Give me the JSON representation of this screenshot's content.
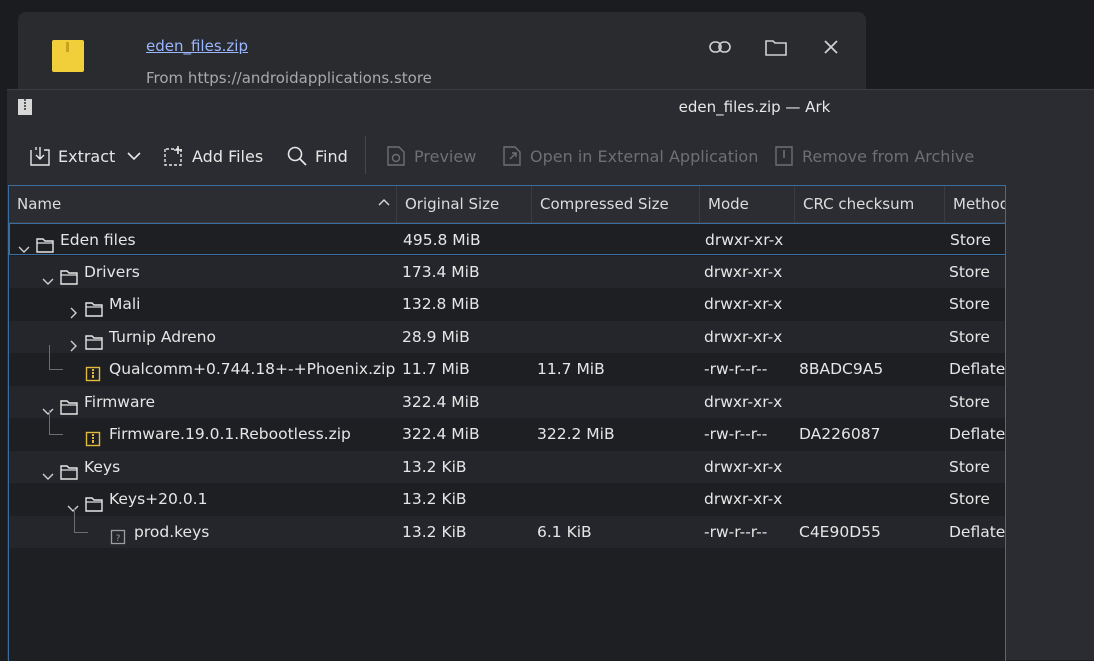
{
  "notification": {
    "filename": "eden_files.zip",
    "source": "From https://androidapplications.store"
  },
  "window": {
    "title": "eden_files.zip — Ark"
  },
  "toolbar": {
    "extract": "Extract",
    "add_files": "Add Files",
    "find": "Find",
    "preview": "Preview",
    "open_external": "Open in External Application",
    "remove": "Remove from Archive"
  },
  "columns": [
    "Name",
    "Original Size",
    "Compressed Size",
    "Mode",
    "CRC checksum",
    "Method"
  ],
  "rows": [
    {
      "name": "Eden files",
      "size": "495.8 MiB",
      "compressed": "",
      "mode": "drwxr-xr-x",
      "crc": "",
      "method": "Store",
      "type": "folder",
      "depth": 0,
      "expanded": true
    },
    {
      "name": "Drivers",
      "size": "173.4 MiB",
      "compressed": "",
      "mode": "drwxr-xr-x",
      "crc": "",
      "method": "Store",
      "type": "folder",
      "depth": 1,
      "expanded": true
    },
    {
      "name": "Mali",
      "size": "132.8 MiB",
      "compressed": "",
      "mode": "drwxr-xr-x",
      "crc": "",
      "method": "Store",
      "type": "folder",
      "depth": 2,
      "expanded": false
    },
    {
      "name": "Turnip Adreno",
      "size": "28.9 MiB",
      "compressed": "",
      "mode": "drwxr-xr-x",
      "crc": "",
      "method": "Store",
      "type": "folder",
      "depth": 2,
      "expanded": false
    },
    {
      "name": "Qualcomm+0.744.18+-+Phoenix.zip",
      "size": "11.7 MiB",
      "compressed": "11.7 MiB",
      "mode": "-rw-r--r--",
      "crc": "8BADC9A5",
      "method": "Deflate",
      "type": "zip",
      "depth": 2
    },
    {
      "name": "Firmware",
      "size": "322.4 MiB",
      "compressed": "",
      "mode": "drwxr-xr-x",
      "crc": "",
      "method": "Store",
      "type": "folder",
      "depth": 1,
      "expanded": true
    },
    {
      "name": "Firmware.19.0.1.Rebootless.zip",
      "size": "322.4 MiB",
      "compressed": "322.2 MiB",
      "mode": "-rw-r--r--",
      "crc": "DA226087",
      "method": "Deflate",
      "type": "zip",
      "depth": 2
    },
    {
      "name": "Keys",
      "size": "13.2 KiB",
      "compressed": "",
      "mode": "drwxr-xr-x",
      "crc": "",
      "method": "Store",
      "type": "folder",
      "depth": 1,
      "expanded": true
    },
    {
      "name": "Keys+20.0.1",
      "size": "13.2 KiB",
      "compressed": "",
      "mode": "drwxr-xr-x",
      "crc": "",
      "method": "Store",
      "type": "folder",
      "depth": 2,
      "expanded": true
    },
    {
      "name": "prod.keys",
      "size": "13.2 KiB",
      "compressed": "6.1 KiB",
      "mode": "-rw-r--r--",
      "crc": "C4E90D55",
      "method": "Deflate",
      "type": "file",
      "depth": 3
    }
  ]
}
